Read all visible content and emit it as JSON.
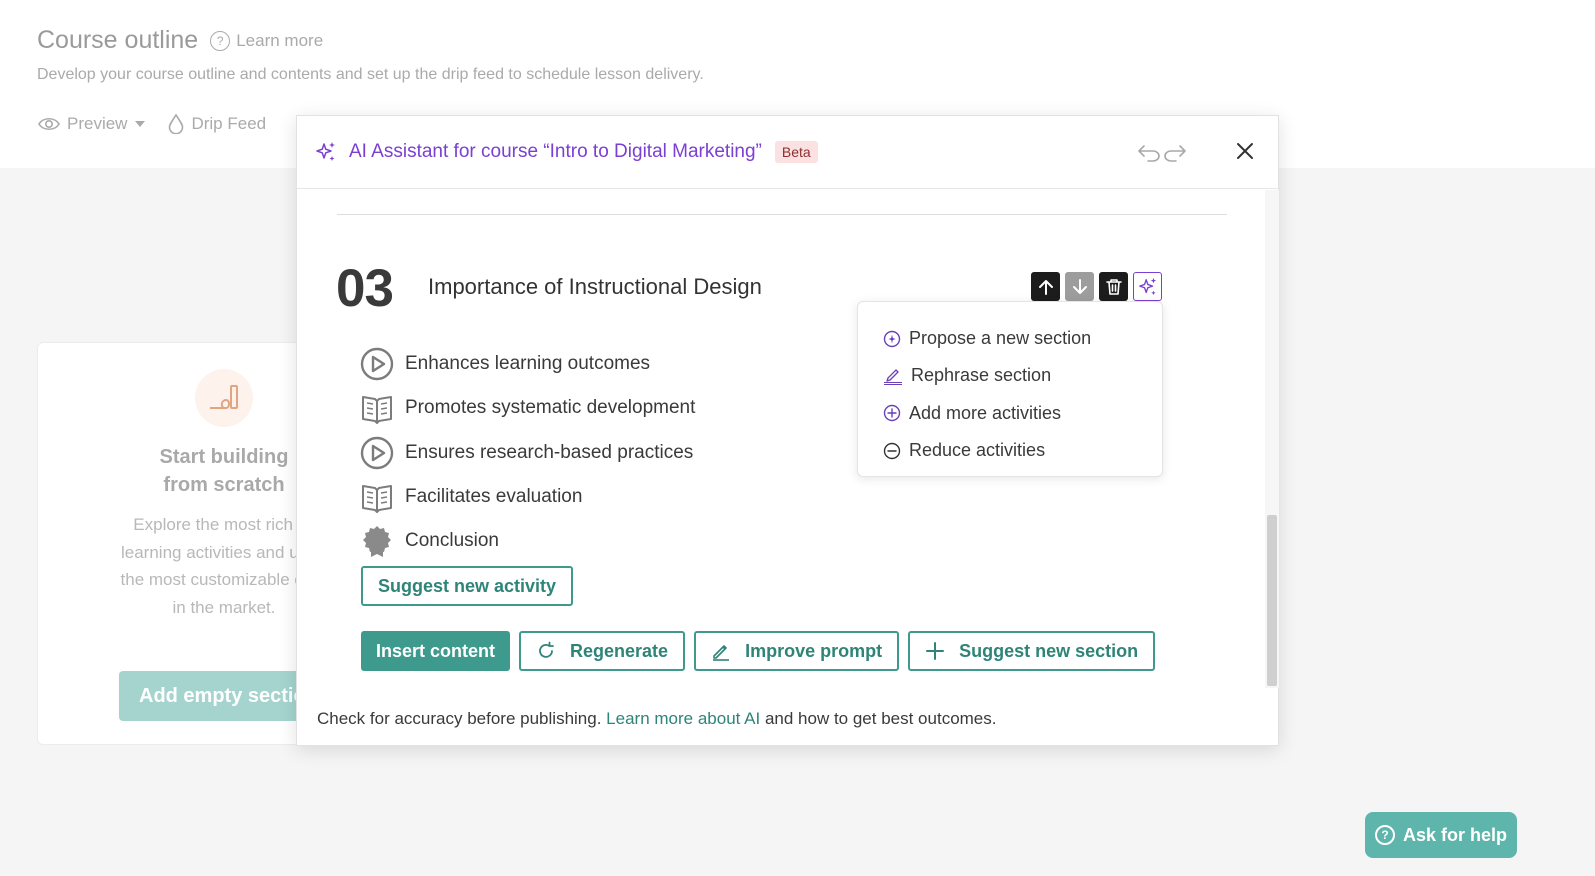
{
  "page": {
    "title": "Course outline",
    "learn_more": "Learn more",
    "subtitle": "Develop your course outline and contents and set up the drip feed to schedule lesson delivery.",
    "toolbar": {
      "preview": "Preview",
      "drip_feed": "Drip Feed"
    }
  },
  "scratch_card": {
    "title_line1": "Start building",
    "title_line2": "from scratch",
    "text_line1": "Explore the most rich lib",
    "text_line2": "learning activities and unde",
    "text_line3": "the most customizable cour",
    "text_line4": "in the market.",
    "button": "Add empty sectio"
  },
  "help": {
    "label": "Ask for help"
  },
  "modal": {
    "title": "AI Assistant for course “Intro to Digital Marketing”",
    "badge": "Beta",
    "section": {
      "number": "03",
      "title": "Importance of Instructional Design",
      "activities": [
        {
          "label": "Enhances learning outcomes",
          "icon": "play-icon"
        },
        {
          "label": "Promotes systematic development",
          "icon": "book-icon"
        },
        {
          "label": "Ensures research-based practices",
          "icon": "play-icon"
        },
        {
          "label": "Facilitates evaluation",
          "icon": "book-icon"
        },
        {
          "label": "Conclusion",
          "icon": "award-icon"
        }
      ],
      "suggest_activity": "Suggest new activity"
    },
    "menu": {
      "items": [
        {
          "label": "Propose a new section",
          "icon": "propose-icon"
        },
        {
          "label": "Rephrase section",
          "icon": "rephrase-icon"
        },
        {
          "label": "Add more activities",
          "icon": "plus-circle-icon"
        },
        {
          "label": "Reduce activities",
          "icon": "minus-circle-icon"
        }
      ]
    },
    "actions": {
      "insert": "Insert content",
      "regenerate": "Regenerate",
      "improve": "Improve prompt",
      "suggest_section": "Suggest new section"
    },
    "footer": {
      "text_before": "Check for accuracy before publishing.",
      "link": "Learn more about AI",
      "text_after": "and how to get best outcomes."
    }
  },
  "colors": {
    "accent_teal": "#3f9a8e",
    "ai_purple": "#7a3fd3",
    "beta_bg": "#fbe1e1"
  }
}
